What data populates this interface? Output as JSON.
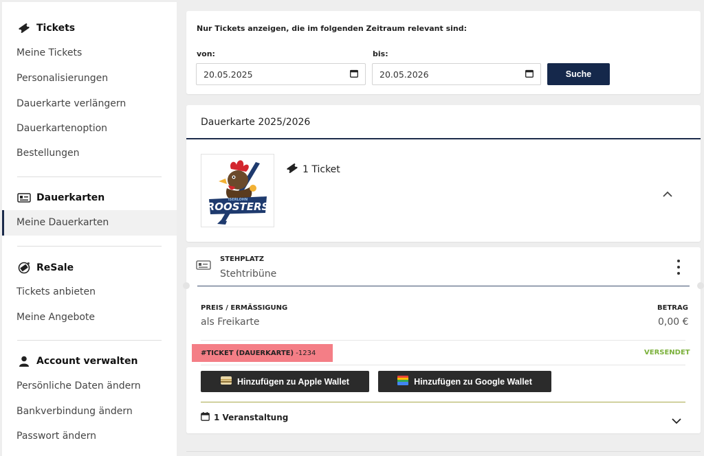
{
  "sidebar": {
    "tickets": {
      "heading": "Tickets",
      "items": [
        "Meine Tickets",
        "Personalisierungen",
        "Dauerkarte verlängern",
        "Dauerkartenoption",
        "Bestellungen"
      ]
    },
    "dauerkarten": {
      "heading": "Dauerkarten",
      "items": [
        "Meine Dauerkarten"
      ]
    },
    "resale": {
      "heading": "ReSale",
      "items": [
        "Tickets anbieten",
        "Meine Angebote"
      ]
    },
    "account": {
      "heading": "Account verwalten",
      "items": [
        "Persönliche Daten ändern",
        "Bankverbindung ändern",
        "Passwort ändern"
      ]
    }
  },
  "filter": {
    "title": "Nur Tickets anzeigen, die im folgenden Zeitraum relevant sind:",
    "from_label": "von:",
    "from_value": "20.05.2025",
    "to_label": "bis:",
    "to_value": "20.05.2026",
    "search_label": "Suche"
  },
  "season_card": {
    "title": "Dauerkarte 2025/2026",
    "ticket_count": "1 Ticket"
  },
  "ticket": {
    "type_label": "STEHPLATZ",
    "type_value": "Stehtribüne",
    "price_label": "PREIS / ERMÄSSIGUNG",
    "price_value": "als Freikarte",
    "amount_label": "BETRAG",
    "amount_value": "0,00 €",
    "number_label": "#TICKET (DAUERKARTE)",
    "number_value": "-1234",
    "status": "VERSENDET",
    "apple_wallet": "Hinzufügen zu Apple Wallet",
    "google_wallet": "Hinzufügen zu Google Wallet",
    "events": "1 Veranstaltung"
  },
  "colors": {
    "navy": "#15284b",
    "status_green": "#7ab03a",
    "highlight": "#f47e86"
  }
}
